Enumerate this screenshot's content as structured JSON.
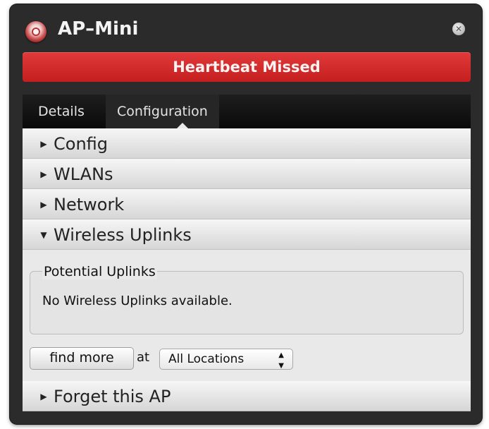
{
  "window": {
    "title": "AP–Mini",
    "close_glyph": "✕",
    "close_icon": "close-icon",
    "app_icon": "access-point-icon"
  },
  "banner": {
    "text": "Heartbeat Missed",
    "color": "#d42828"
  },
  "tabs": [
    {
      "label": "Details",
      "selected": false
    },
    {
      "label": "Configuration",
      "selected": true
    }
  ],
  "sections": [
    {
      "label": "Config",
      "expanded": false,
      "glyph": "▶"
    },
    {
      "label": "WLANs",
      "expanded": false,
      "glyph": "▶"
    },
    {
      "label": "Network",
      "expanded": false,
      "glyph": "▶"
    },
    {
      "label": "Wireless Uplinks",
      "expanded": true,
      "glyph": "▼"
    },
    {
      "label": "Forget this AP",
      "expanded": false,
      "glyph": "▶"
    }
  ],
  "uplinks": {
    "group_title": "Potential Uplinks",
    "message": "No Wireless Uplinks available.",
    "find_button": "find more",
    "at_label": "at",
    "location_select": {
      "value": "All Locations",
      "arrows": "▲▼"
    }
  }
}
